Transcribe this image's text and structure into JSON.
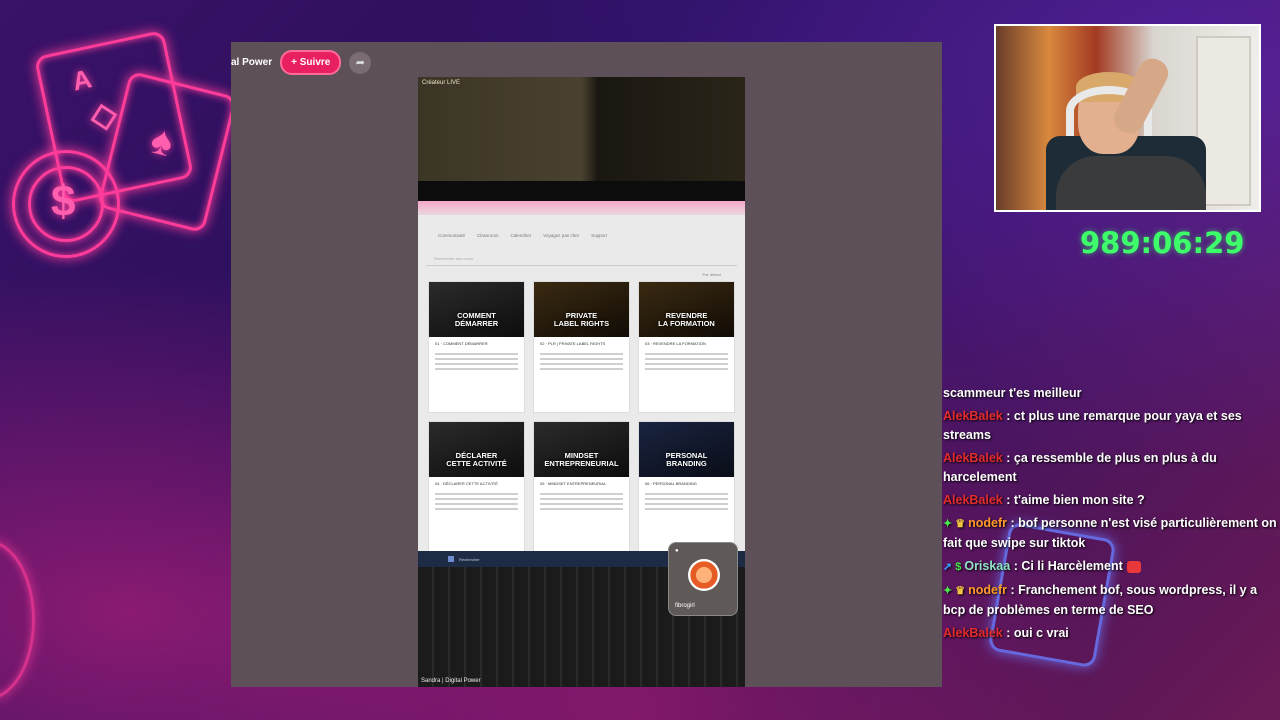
{
  "stream": {
    "timer": "989:06:29"
  },
  "overlay": {
    "channel_name": "al Power",
    "follow_label": "+ Suivre",
    "share_icon": "➦"
  },
  "phone_video": {
    "live_label": "Créateur LIVE",
    "footer_label": "Sandra | Digital Power",
    "nav_items": [
      "Communauté",
      "Classroom",
      "Calendrier",
      "Voyagez pas cher",
      "Support"
    ],
    "search_placeholder": "Rechercher des cours",
    "sort_label": "Par défaut",
    "courses": [
      {
        "title": "COMMENT\nDÉMARRER",
        "meta": "01 · COMMENT DÉMARRER"
      },
      {
        "title": "PRIVATE\nLABEL RIGHTS",
        "meta": "02 · PLR | PRIVATE LABEL RIGHTS"
      },
      {
        "title": "REVENDRE\nLA FORMATION",
        "meta": "03 · REVENDRE LA FORMATION"
      },
      {
        "title": "DÉCLARER\nCETTE ACTIVITÉ",
        "meta": "04 · DÉCLARER CETTE ACTIVITÉ"
      },
      {
        "title": "MINDSET\nENTREPRENEURIAL",
        "meta": "05 · MINDSET ENTREPRENEURIAL"
      },
      {
        "title": "PERSONAL\nBRANDING",
        "meta": "06 · PERSONAL BRANDING"
      }
    ],
    "taskbar_search": "Rechercher",
    "sticker_name": "fibrogirl"
  },
  "chat": {
    "messages": [
      {
        "user": "",
        "text": "scammeur t'es meilleur"
      },
      {
        "user": "AlekBalek",
        "text": " : ct plus une remarque pour yaya et ses streams"
      },
      {
        "user": "AlekBalek",
        "text": " : ça ressemble de plus en plus à du harcelement"
      },
      {
        "user": "AlekBalek",
        "text": " : t'aime bien mon site ?"
      },
      {
        "user": "nodefr",
        "text": " : bof personne n'est visé particulièrement on fait que swipe sur tiktok"
      },
      {
        "user": "Oriskaa",
        "text": " : Ci li Harcèlement"
      },
      {
        "user": "nodefr",
        "text": " : Franchement bof, sous wordpress, il y a bcp de problèmes en terme de SEO"
      },
      {
        "user": "AlekBalek",
        "text": " : oui c vrai"
      }
    ]
  },
  "colors": {
    "timer": "#3dff6a",
    "follow_button": "#e8205f",
    "neon": "#ff3c9a"
  }
}
